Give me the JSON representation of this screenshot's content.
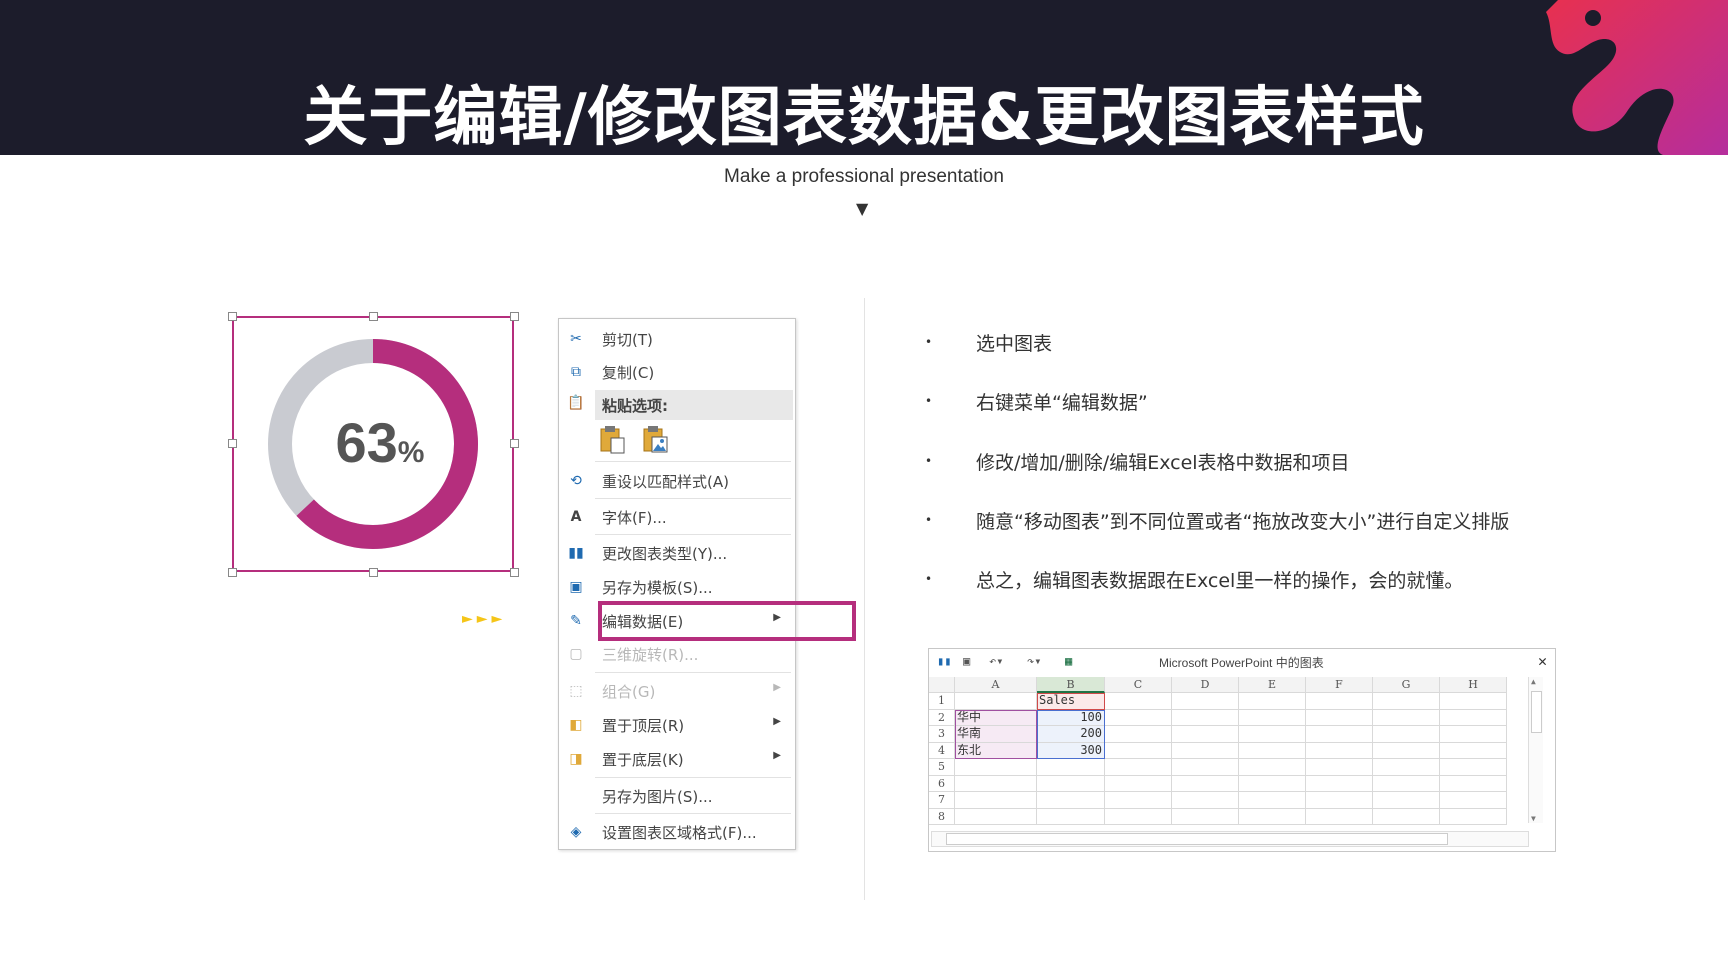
{
  "header": {
    "title": "关于编辑/修改图表数据&更改图表样式",
    "subtitle": "Make a professional presentation"
  },
  "colors": {
    "accent": "#b52e7d",
    "header_bg": "#1c1c2b",
    "donut_track": "#c9cbd1",
    "arrow": "#f5c518"
  },
  "chart_data": {
    "type": "pie",
    "style": "donut",
    "values": [
      63,
      37
    ],
    "value_label": "63",
    "unit_label": "%"
  },
  "context_menu": {
    "items": [
      {
        "label": "剪切(T)",
        "icon": "scissors-icon",
        "disabled": false
      },
      {
        "label": "复制(C)",
        "icon": "copy-icon",
        "disabled": false
      },
      {
        "label": "粘贴选项:",
        "icon": "paste-icon",
        "disabled": false
      },
      {
        "label": "重设以匹配样式(A)",
        "icon": "reset-style-icon",
        "disabled": false
      },
      {
        "label": "字体(F)...",
        "icon": "font-icon",
        "disabled": false
      },
      {
        "label": "更改图表类型(Y)...",
        "icon": "chart-type-icon",
        "disabled": false
      },
      {
        "label": "另存为模板(S)...",
        "icon": "save-template-icon",
        "disabled": false
      },
      {
        "label": "编辑数据(E)",
        "icon": "edit-data-icon",
        "disabled": false
      },
      {
        "label": "三维旋转(R)...",
        "icon": "3d-rotate-icon",
        "disabled": true
      },
      {
        "label": "组合(G)",
        "icon": "group-icon",
        "disabled": true
      },
      {
        "label": "置于顶层(R)",
        "icon": "bring-front-icon",
        "disabled": false
      },
      {
        "label": "置于底层(K)",
        "icon": "send-back-icon",
        "disabled": false
      },
      {
        "label": "另存为图片(S)...",
        "icon": "",
        "disabled": false
      },
      {
        "label": "设置图表区域格式(F)...",
        "icon": "format-chart-icon",
        "disabled": false
      }
    ]
  },
  "bullets": [
    "选中图表",
    "右键菜单“编辑数据”",
    "修改/增加/删除/编辑Excel表格中数据和项目",
    "随意“移动图表”到不同位置或者“拖放改变大小”进行自定义排版",
    "总之，编辑图表数据跟在Excel里一样的操作，会的就懂。"
  ],
  "excel": {
    "title": "Microsoft PowerPoint 中的图表",
    "columns": [
      "A",
      "B",
      "C",
      "D",
      "E",
      "F",
      "G",
      "H"
    ],
    "rows": [
      "1",
      "2",
      "3",
      "4",
      "5",
      "6",
      "7",
      "8"
    ],
    "cells": {
      "B1": "Sales",
      "A2": "华中",
      "B2": "100",
      "A3": "华南",
      "B3": "200",
      "A4": "东北",
      "B4": "300"
    }
  }
}
